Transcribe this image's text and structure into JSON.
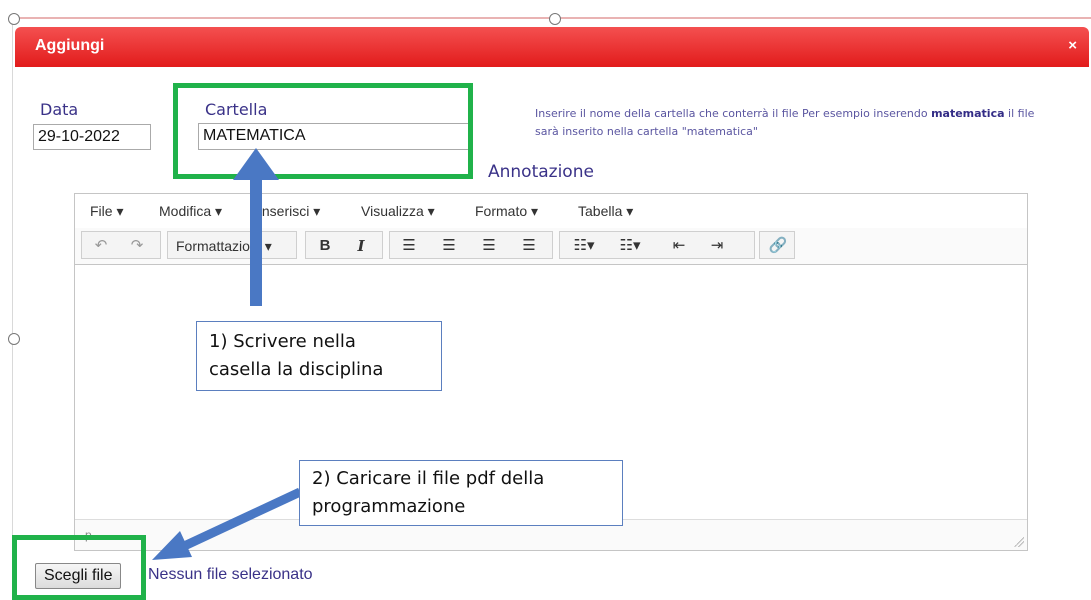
{
  "dialog": {
    "title": "Aggiungi",
    "close_label": "×"
  },
  "form": {
    "data_label": "Data",
    "data_value": "29-10-2022",
    "cartella_label": "Cartella",
    "cartella_value": "MATEMATICA",
    "annotazione_label": "Annotazione",
    "hint_part1": "Inserire il nome della cartella che conterrà il file Per esempio inserendo ",
    "hint_bold": "matematica",
    "hint_part2": " il file sarà inserito nella cartella \"matematica\""
  },
  "editor": {
    "menu": [
      "File ▾",
      "Modifica ▾",
      "Inserisci ▾",
      "Visualizza ▾",
      "Formato ▾",
      "Tabella ▾"
    ],
    "format_label": "Formattazioni ▾",
    "status_path": "p"
  },
  "file": {
    "button_label": "Scegli file",
    "status": "Nessun file selezionato"
  },
  "annotations": {
    "callout1_line1": "1) Scrivere nella",
    "callout1_line2": "casella la disciplina",
    "callout2_line1": "2) Caricare il file pdf della",
    "callout2_line2": "programmazione"
  },
  "colors": {
    "header": "#e21b1b",
    "highlight_box": "#20b24a",
    "arrow": "#4a78c4",
    "label_text": "#3a3288"
  }
}
